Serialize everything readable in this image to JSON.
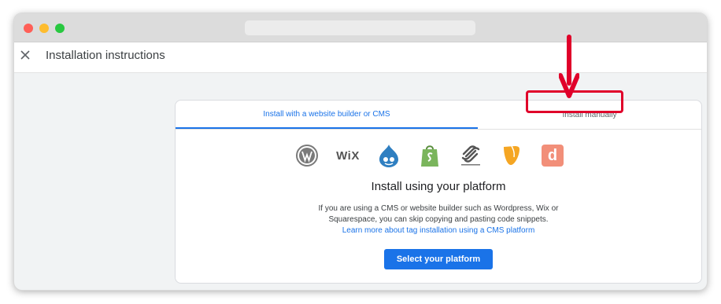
{
  "header": {
    "title": "Installation instructions"
  },
  "tabs": [
    {
      "label": "Install with a website builder or CMS",
      "active": true
    },
    {
      "label": "Install manually",
      "active": false
    }
  ],
  "platforms": [
    "wordpress-icon",
    "wix-icon",
    "drupal-icon",
    "shopify-icon",
    "squarespace-icon",
    "typo3-icon",
    "duda-icon"
  ],
  "logos": {
    "wix_text": "WiX",
    "duda_text": "d"
  },
  "content": {
    "title": "Install using your platform",
    "description": "If you are using a CMS or website builder such as Wordpress, Wix or Squarespace, you can skip copying and pasting code snippets.",
    "link": "Learn more about tag installation using a CMS platform",
    "button": "Select your platform"
  },
  "colors": {
    "accent": "#1a73e8",
    "annotation": "#e0002a"
  }
}
